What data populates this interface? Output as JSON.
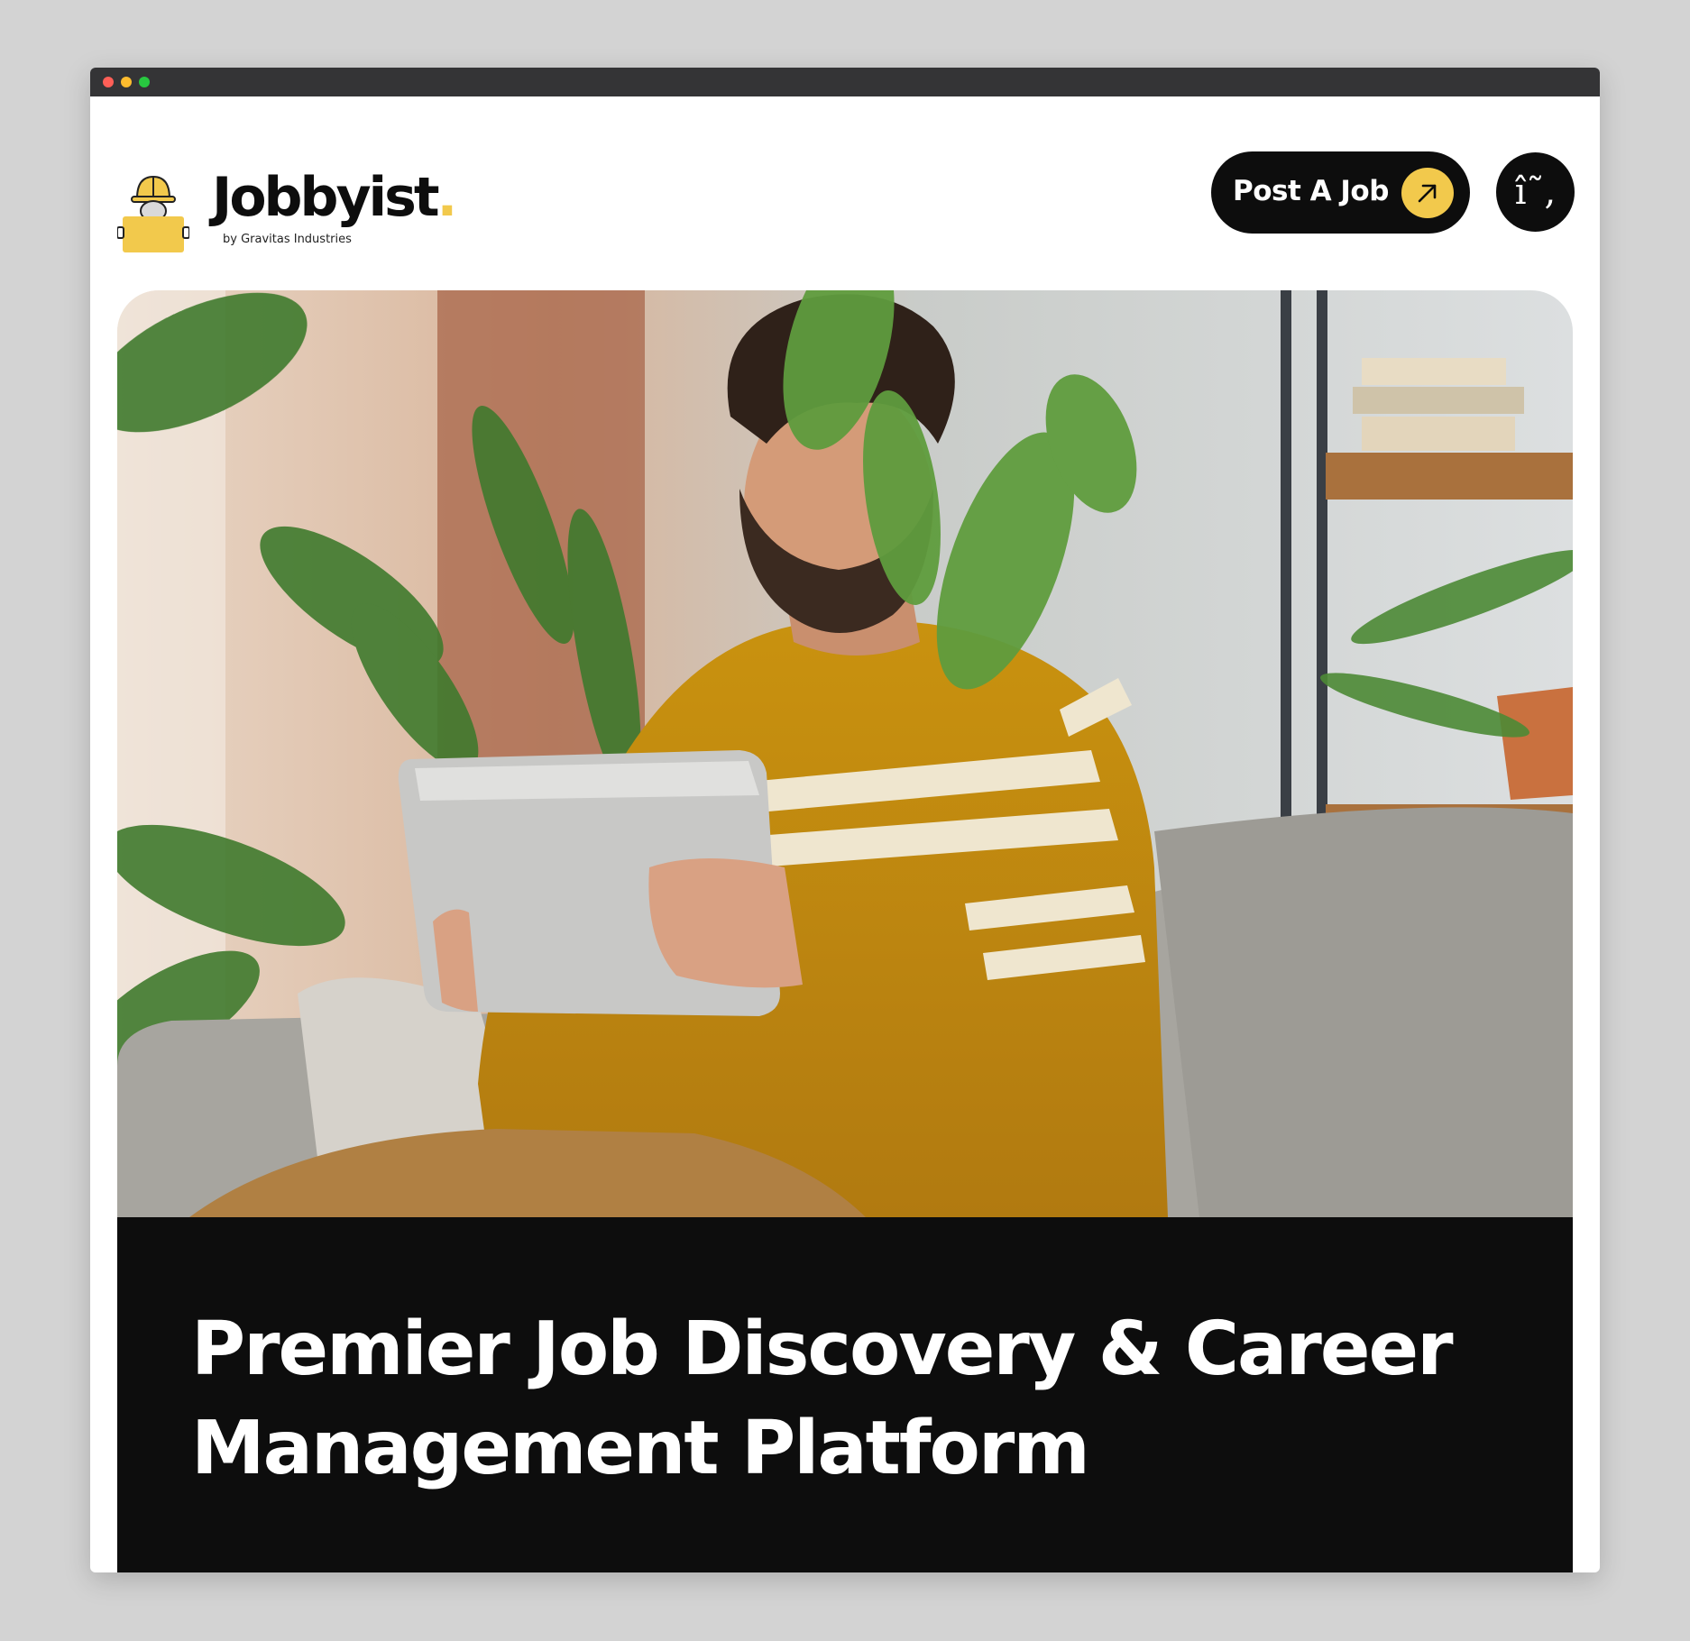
{
  "header": {
    "brand_name": "Jobbyist",
    "brand_dot": ".",
    "brand_subtitle": "by Gravitas Industries",
    "post_job_label": "Post A Job",
    "menu_icon_glyph": "î˜,",
    "menu_icon": "menu-icon",
    "accent_color": "#f2c94c",
    "dark_color": "#0d0d0d"
  },
  "hero": {
    "image_alt": "Man in yellow striped sweater using a tablet on a sofa surrounded by plants",
    "title": "Premier Job Discovery & Career Management Platform"
  }
}
